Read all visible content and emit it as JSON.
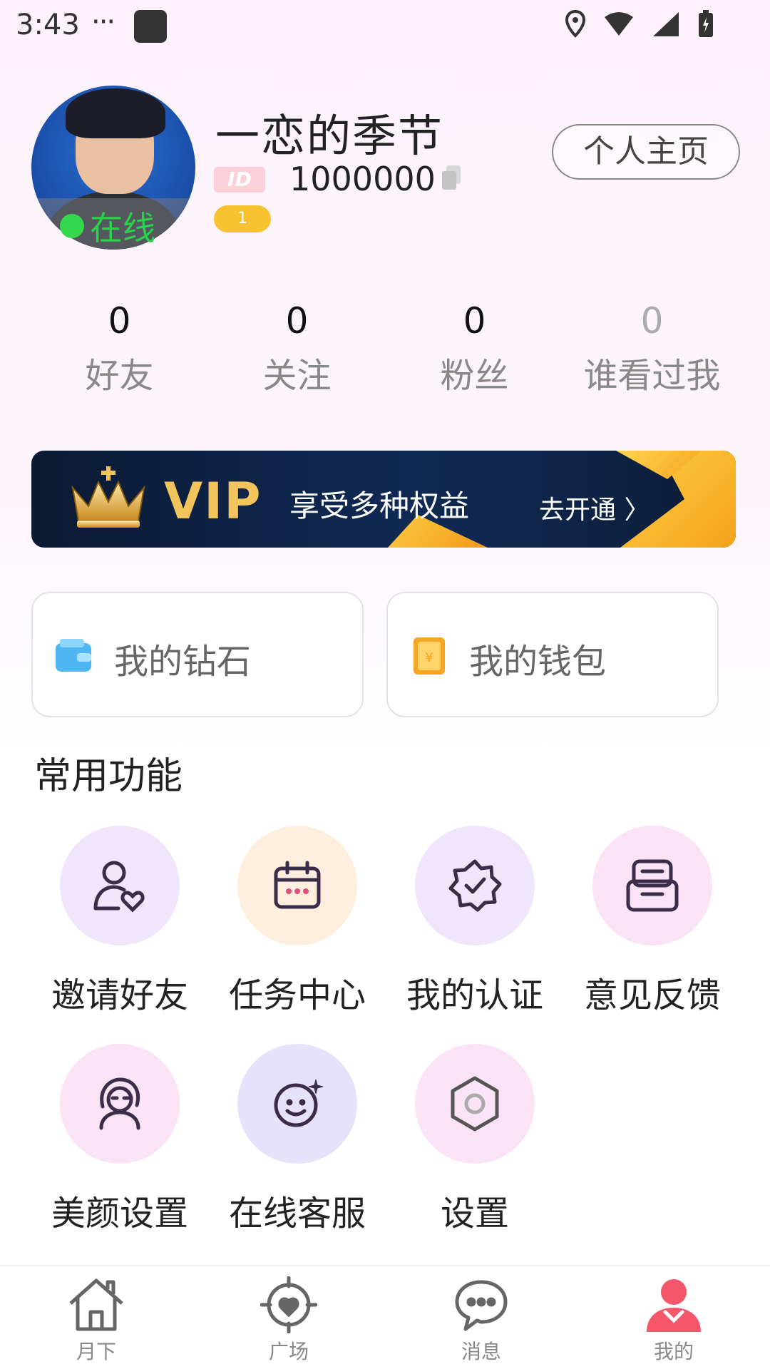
{
  "status_bar": {
    "time": "3:43",
    "dots": "···"
  },
  "profile": {
    "username": "一恋的季节",
    "online_status": "在线",
    "id_tag": "ID",
    "id_value": "1000000",
    "level": "1",
    "homepage_button": "个人主页"
  },
  "stats": [
    {
      "value": "0",
      "label": "好友"
    },
    {
      "value": "0",
      "label": "关注"
    },
    {
      "value": "0",
      "label": "粉丝"
    },
    {
      "value": "0",
      "label": "谁看过我"
    }
  ],
  "vip": {
    "title": "VIP",
    "description": "享受多种权益",
    "cta": "去开通 〉"
  },
  "wallet": {
    "diamonds": "我的钻石",
    "wallet": "我的钱包"
  },
  "section_title": "常用功能",
  "features": [
    {
      "label": "邀请好友",
      "icon": "invite-friend-icon",
      "bg": "#efe6fb"
    },
    {
      "label": "任务中心",
      "icon": "calendar-icon",
      "bg": "#fdeedd"
    },
    {
      "label": "我的认证",
      "icon": "verified-badge-icon",
      "bg": "#efe6fb"
    },
    {
      "label": "意见反馈",
      "icon": "feedback-icon",
      "bg": "#fbe3f6"
    },
    {
      "label": "美颜设置",
      "icon": "beauty-icon",
      "bg": "#fbe3f6"
    },
    {
      "label": "在线客服",
      "icon": "customer-service-icon",
      "bg": "#e6e2fb"
    },
    {
      "label": "设置",
      "icon": "settings-icon",
      "bg": "#fbe3f6"
    }
  ],
  "bottom_nav": [
    {
      "label": "月下",
      "icon": "home-icon",
      "active": false
    },
    {
      "label": "广场",
      "icon": "plaza-icon",
      "active": false
    },
    {
      "label": "消息",
      "icon": "message-icon",
      "active": false
    },
    {
      "label": "我的",
      "icon": "profile-icon",
      "active": true
    }
  ],
  "colors": {
    "online_green": "#29d24a",
    "vip_gold": "#f2c55c",
    "active_nav": "#f5566a",
    "icon_stroke": "#3b2d4a"
  }
}
